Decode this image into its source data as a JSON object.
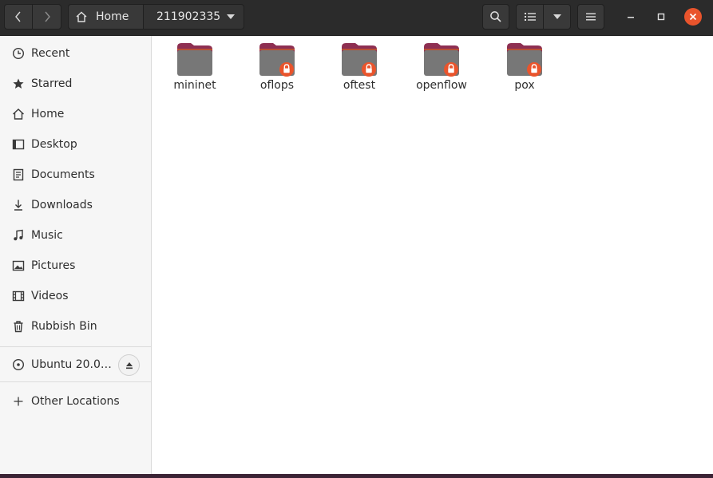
{
  "header": {
    "path": [
      "Home",
      "211902335"
    ],
    "icons": {
      "back": "chevron-left-icon",
      "forward": "chevron-right-icon",
      "home": "home-icon",
      "search": "search-icon",
      "list_view": "list-view-icon",
      "menu": "hamburger-icon"
    }
  },
  "sidebar": {
    "places": [
      {
        "label": "Recent",
        "icon": "clock-icon"
      },
      {
        "label": "Starred",
        "icon": "star-icon"
      },
      {
        "label": "Home",
        "icon": "home-icon"
      },
      {
        "label": "Desktop",
        "icon": "desktop-icon"
      },
      {
        "label": "Documents",
        "icon": "document-icon"
      },
      {
        "label": "Downloads",
        "icon": "download-icon"
      },
      {
        "label": "Music",
        "icon": "music-icon"
      },
      {
        "label": "Pictures",
        "icon": "picture-icon"
      },
      {
        "label": "Videos",
        "icon": "video-icon"
      },
      {
        "label": "Rubbish Bin",
        "icon": "trash-icon"
      }
    ],
    "devices": [
      {
        "label": "Ubuntu 20.0…",
        "icon": "disc-icon"
      }
    ],
    "other": {
      "label": "Other Locations",
      "icon": "plus-icon"
    }
  },
  "folders": [
    {
      "name": "mininet",
      "locked": false
    },
    {
      "name": "oflops",
      "locked": true
    },
    {
      "name": "oftest",
      "locked": true
    },
    {
      "name": "openflow",
      "locked": true
    },
    {
      "name": "pox",
      "locked": true
    }
  ],
  "colors": {
    "folder_body": "#777777",
    "folder_tab": "#8e2f52",
    "lock_badge": "#e9542c",
    "close_button": "#e9542c"
  }
}
